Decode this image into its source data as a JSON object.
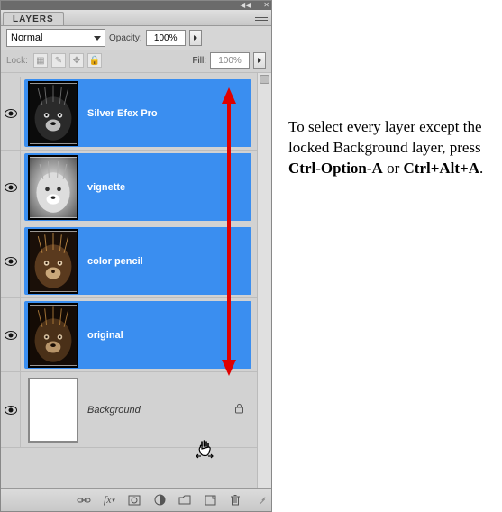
{
  "panel": {
    "title": "LAYERS",
    "blend_mode": "Normal",
    "opacity_label": "Opacity:",
    "opacity_value": "100%",
    "lock_label": "Lock:",
    "fill_label": "Fill:",
    "fill_value": "100%"
  },
  "layers": [
    {
      "name": "Silver Efex Pro",
      "selected": true,
      "visible": true,
      "locked": false,
      "thumb": "silverefex"
    },
    {
      "name": "vignette",
      "selected": true,
      "visible": true,
      "locked": false,
      "thumb": "vignette"
    },
    {
      "name": "color pencil",
      "selected": true,
      "visible": true,
      "locked": false,
      "thumb": "colorpencil"
    },
    {
      "name": "original",
      "selected": true,
      "visible": true,
      "locked": false,
      "thumb": "original"
    },
    {
      "name": "Background",
      "selected": false,
      "visible": true,
      "locked": true,
      "thumb": "blank"
    }
  ],
  "footer_icons": [
    "link-icon",
    "fx-icon",
    "mask-icon",
    "adjustment-icon",
    "group-icon",
    "new-layer-icon",
    "trash-icon"
  ],
  "caption": {
    "line1": "To select every layer except the locked Background layer, press ",
    "shortcut1": "Ctrl-Option-A",
    "or": " or ",
    "shortcut2": "Ctrl+Alt+A",
    "end": "."
  }
}
